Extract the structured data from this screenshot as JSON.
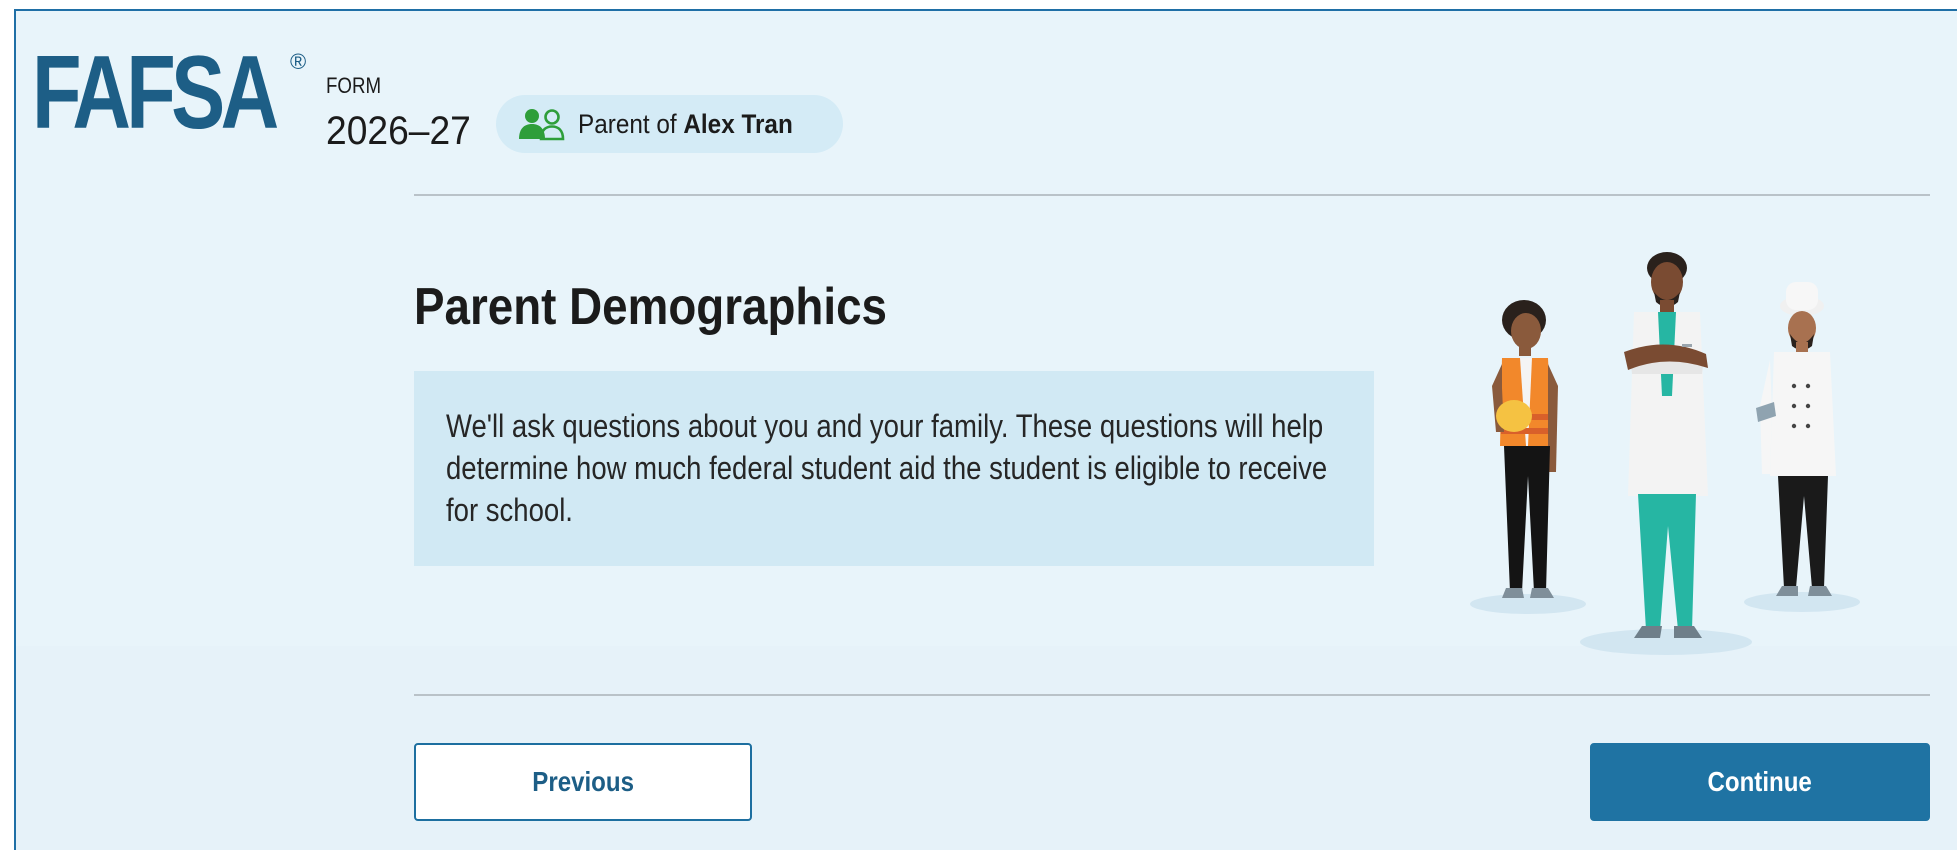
{
  "header": {
    "logo_text": "FAFSA",
    "logo_mark": "®",
    "form_label": "FORM",
    "form_year": "2026–27",
    "role": {
      "icon": "parent-student-icon",
      "prefix": "Parent of",
      "student_name": "Alex Tran"
    }
  },
  "main": {
    "title": "Parent Demographics",
    "info": "We'll ask questions about you and your family. These questions will help determine how much federal student aid the student is eligible to receive for school.",
    "illustration": "three-workers-illustration"
  },
  "nav": {
    "previous_label": "Previous",
    "continue_label": "Continue"
  },
  "colors": {
    "brand": "#1d5e86",
    "primary_button": "#1f73a3",
    "page_background": "#e8f4fa",
    "info_background": "#d1e9f4",
    "role_icon": "#2e9e3a"
  }
}
